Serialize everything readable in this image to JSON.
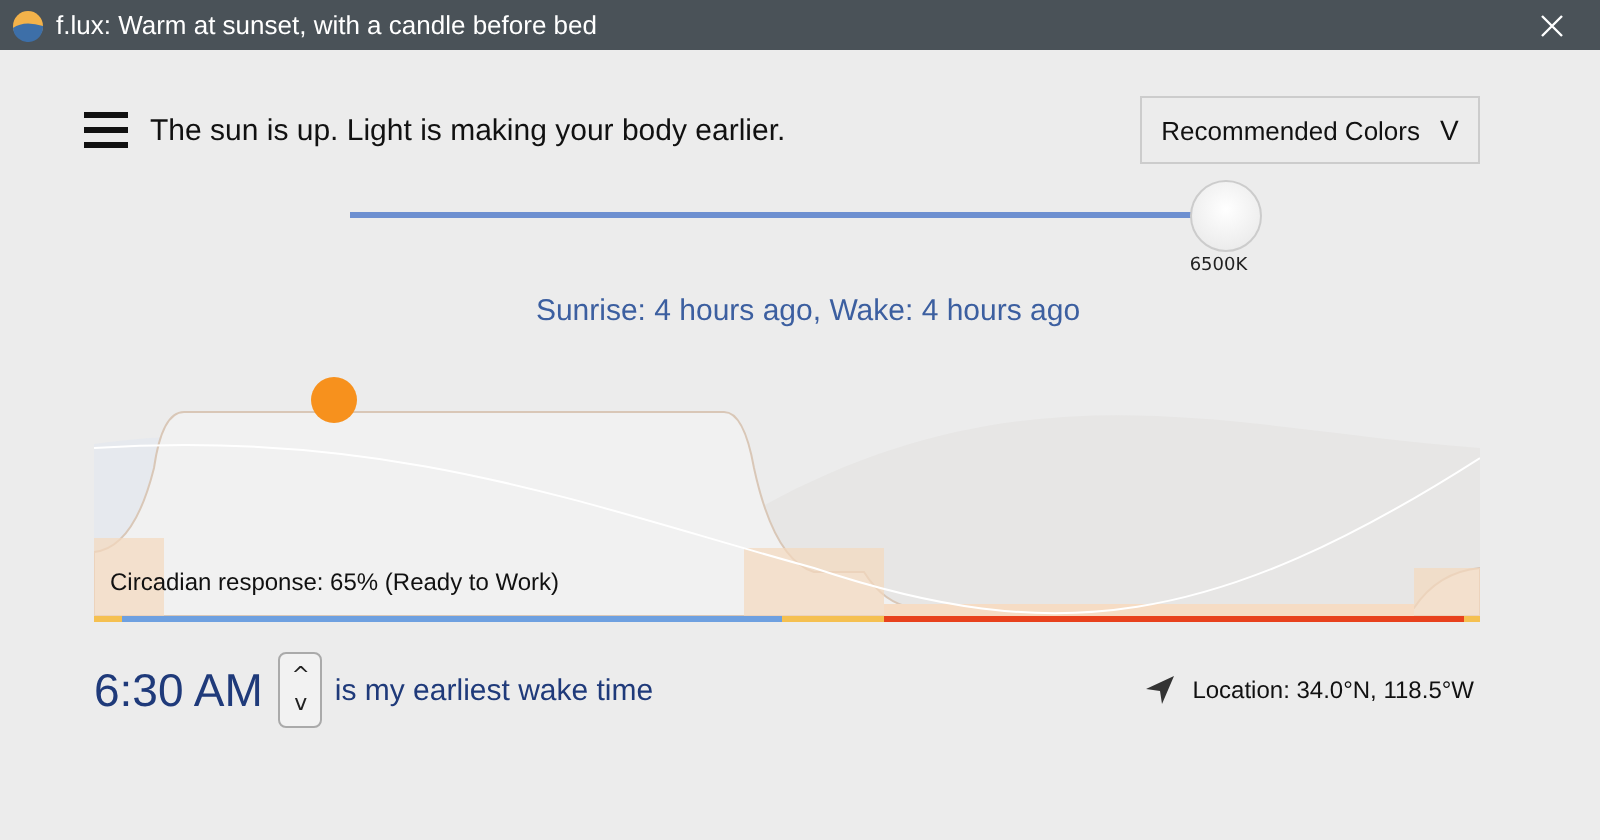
{
  "window": {
    "title": "f.lux: Warm at sunset, with a candle before bed"
  },
  "status_message": "The sun is up. Light is making your body earlier.",
  "preset_dropdown": {
    "label": "Recommended Colors",
    "caret": "V"
  },
  "color_slider": {
    "level": 1,
    "reading": "6500K"
  },
  "sun_info": "Sunrise: 4 hours ago, Wake: 4 hours ago",
  "chart": {
    "caption": "Circadian response: 65% (Ready to Work)"
  },
  "wake_time": {
    "value": "6:30 AM",
    "up": "^",
    "down": "v",
    "caption": "is my earliest wake time"
  },
  "location": "Location: 34.0°N, 118.5°W"
}
